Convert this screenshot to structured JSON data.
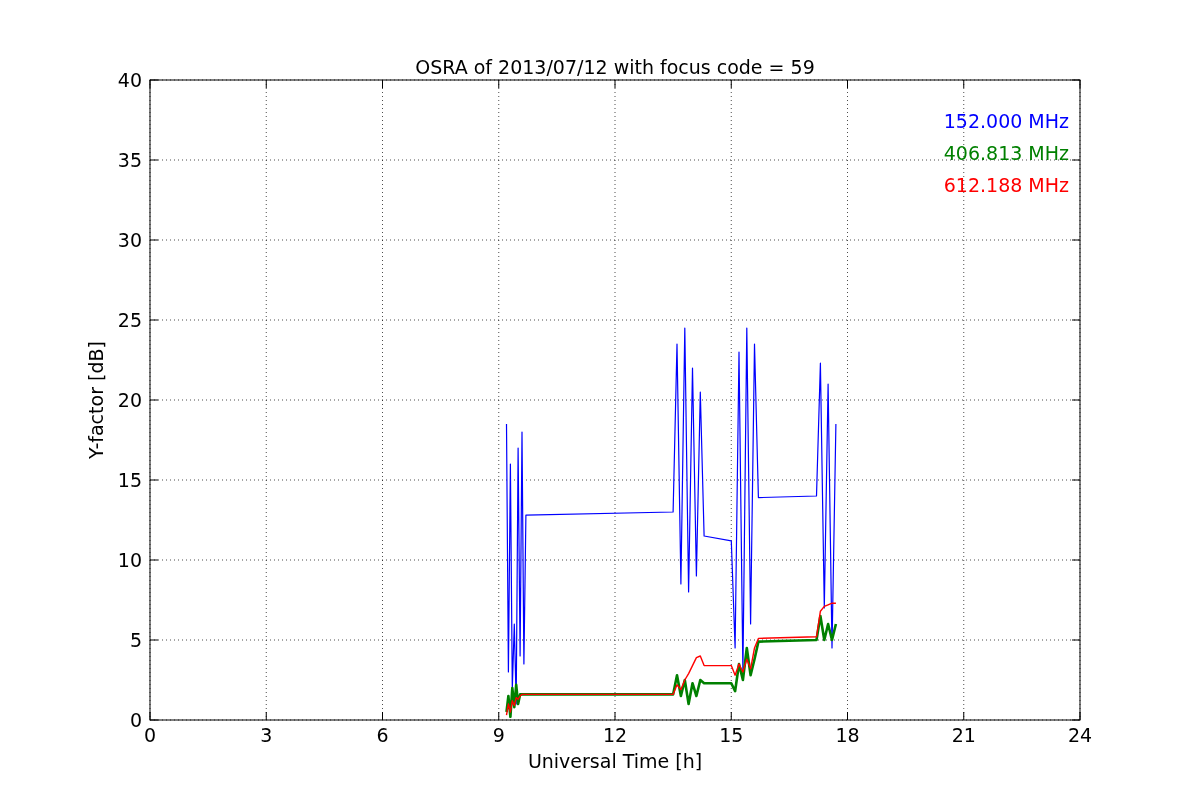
{
  "chart_data": {
    "type": "line",
    "title": "OSRA of 2013/07/12 with focus code = 59",
    "xlabel": "Universal Time [h]",
    "ylabel": "Y-factor [dB]",
    "x": [
      9.2,
      9.25,
      9.3,
      9.35,
      9.4,
      9.45,
      9.5,
      9.55,
      9.6,
      9.65,
      9.7,
      13.5,
      13.6,
      13.7,
      13.8,
      13.9,
      14.0,
      14.1,
      14.2,
      14.3,
      15.0,
      15.1,
      15.2,
      15.3,
      15.4,
      15.5,
      15.6,
      15.7,
      17.2,
      17.3,
      17.4,
      17.5,
      17.6,
      17.7
    ],
    "series": [
      {
        "name": "152.000 MHz",
        "color": "#0000ff",
        "values": [
          18.5,
          3,
          16,
          2,
          6,
          1,
          17,
          4,
          18,
          3.5,
          12.8,
          13,
          23.5,
          8.5,
          24.5,
          8,
          22,
          9,
          20.5,
          11.5,
          11.2,
          4.5,
          23,
          3,
          24.5,
          6,
          23.5,
          13.9,
          14,
          22.3,
          7,
          21,
          4.5,
          18.5
        ]
      },
      {
        "name": "406.813 MHz",
        "color": "#008000",
        "values": [
          0.5,
          1.5,
          0.2,
          2,
          0.8,
          2.2,
          1,
          1.6,
          1.6,
          1.6,
          1.6,
          1.6,
          2.8,
          1.5,
          2.5,
          1,
          2.3,
          1.5,
          2.5,
          2.3,
          2.3,
          1.8,
          3.5,
          2.5,
          4.5,
          2.8,
          3.8,
          4.9,
          5,
          6.5,
          5,
          6,
          5,
          6
        ]
      },
      {
        "name": "612.188 MHz",
        "color": "#ff0000",
        "values": [
          0.3,
          1,
          0.5,
          1.2,
          0.9,
          1.4,
          1.3,
          1.5,
          1.6,
          1.6,
          1.6,
          1.6,
          2.2,
          1.9,
          2.5,
          2.9,
          3.4,
          3.9,
          4,
          3.4,
          3.4,
          2.8,
          3.5,
          3,
          3.8,
          3.2,
          4.5,
          5.1,
          5.2,
          6.8,
          7.1,
          7.2,
          7.3,
          7.3
        ]
      }
    ],
    "grid": true,
    "xlim": [
      0,
      24
    ],
    "ylim": [
      0,
      40
    ],
    "xticks": [
      0,
      3,
      6,
      9,
      12,
      15,
      18,
      21,
      24
    ],
    "yticks": [
      0,
      5,
      10,
      15,
      20,
      25,
      30,
      35,
      40
    ]
  }
}
